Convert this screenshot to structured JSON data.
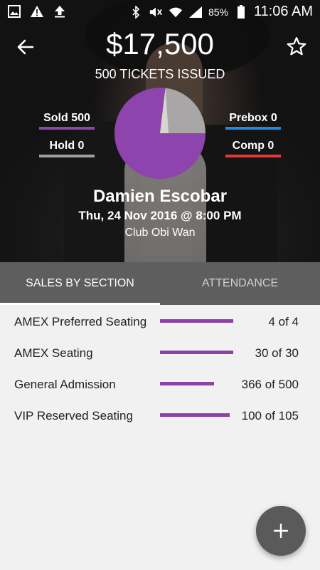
{
  "status_bar": {
    "battery_pct": "85%",
    "time": "11:06 AM",
    "icons": [
      "image-icon",
      "warning-icon",
      "upload-icon",
      "bluetooth-icon",
      "mute-icon",
      "wifi-icon",
      "signal-icon",
      "battery-icon"
    ]
  },
  "header": {
    "amount": "$17,500",
    "tickets_issued": "500 TICKETS ISSUED"
  },
  "legend": {
    "sold": "Sold 500",
    "hold": "Hold 0",
    "prebox": "Prebox 0",
    "comp": "Comp 0"
  },
  "colors": {
    "sold": "#8e44ad",
    "hold": "#9e9e9e",
    "prebox": "#1e88e5",
    "comp": "#e53935",
    "progress": "#8a44a8"
  },
  "chart_data": {
    "type": "pie",
    "slices": [
      {
        "label": "Sold",
        "value": 500
      },
      {
        "label": "Hold",
        "value": 0
      },
      {
        "label": "Prebox",
        "value": 0
      },
      {
        "label": "Comp",
        "value": 0
      }
    ]
  },
  "event": {
    "artist": "Damien Escobar",
    "datetime": "Thu, 24 Nov 2016 @ 8:00 PM",
    "venue": "Club Obi Wan"
  },
  "tabs": [
    {
      "label": "SALES BY SECTION",
      "active": true
    },
    {
      "label": "ATTENDANCE",
      "active": false
    }
  ],
  "sections": [
    {
      "name": "AMEX Preferred Seating",
      "count": "4 of 4",
      "fraction": 0.98
    },
    {
      "name": "AMEX Seating",
      "count": "30 of 30",
      "fraction": 0.98
    },
    {
      "name": "General Admission",
      "count": "366 of 500",
      "fraction": 0.72
    },
    {
      "name": "VIP Reserved Seating",
      "count": "100 of 105",
      "fraction": 0.93
    }
  ]
}
